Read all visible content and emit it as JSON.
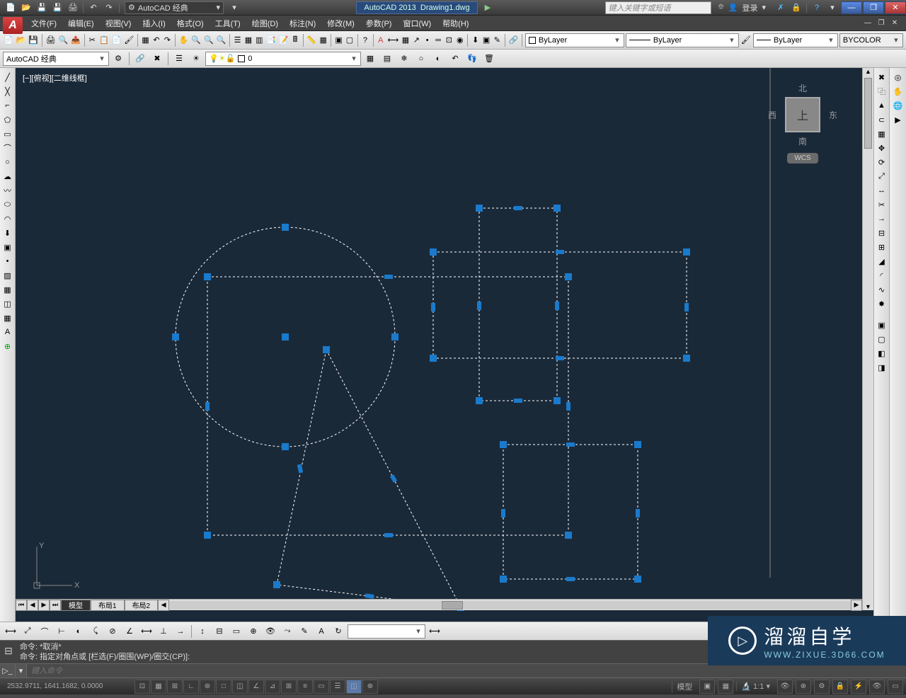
{
  "qat": {
    "workspace": "AutoCAD 经典",
    "app_title": "AutoCAD 2013",
    "doc_title": "Drawing1.dwg",
    "search_placeholder": "键入关键字或短语",
    "login_label": "登录"
  },
  "menus": [
    "文件(F)",
    "编辑(E)",
    "视图(V)",
    "插入(I)",
    "格式(O)",
    "工具(T)",
    "绘图(D)",
    "标注(N)",
    "修改(M)",
    "参数(P)",
    "窗口(W)",
    "帮助(H)"
  ],
  "workspace_combo": "AutoCAD 经典",
  "layer_combo": "0",
  "props": {
    "color": "ByLayer",
    "linetype": "ByLayer",
    "lineweight": "ByLayer",
    "plotstyle": "BYCOLOR"
  },
  "canvas": {
    "view_label": "[−][俯视][二维线框]",
    "viewcube": {
      "north": "北",
      "south": "南",
      "east": "东",
      "west": "西",
      "top": "上",
      "wcs": "WCS"
    },
    "ucs": {
      "x": "X",
      "y": "Y"
    }
  },
  "tabs": {
    "model": "模型",
    "layout1": "布局1",
    "layout2": "布局2"
  },
  "command": {
    "line1": "命令: *取消*",
    "line2": "命令: 指定对角点或 [栏选(F)/圈围(WP)/圈交(CP)]:",
    "input_placeholder": "键入命令"
  },
  "status": {
    "coords": "2532.9711, 1641.1682, 0.0000",
    "model_btn": "模型",
    "scale": "1:1"
  },
  "watermark": {
    "cn": "溜溜自学",
    "url": "WWW.ZIXUE.3D66.COM"
  }
}
